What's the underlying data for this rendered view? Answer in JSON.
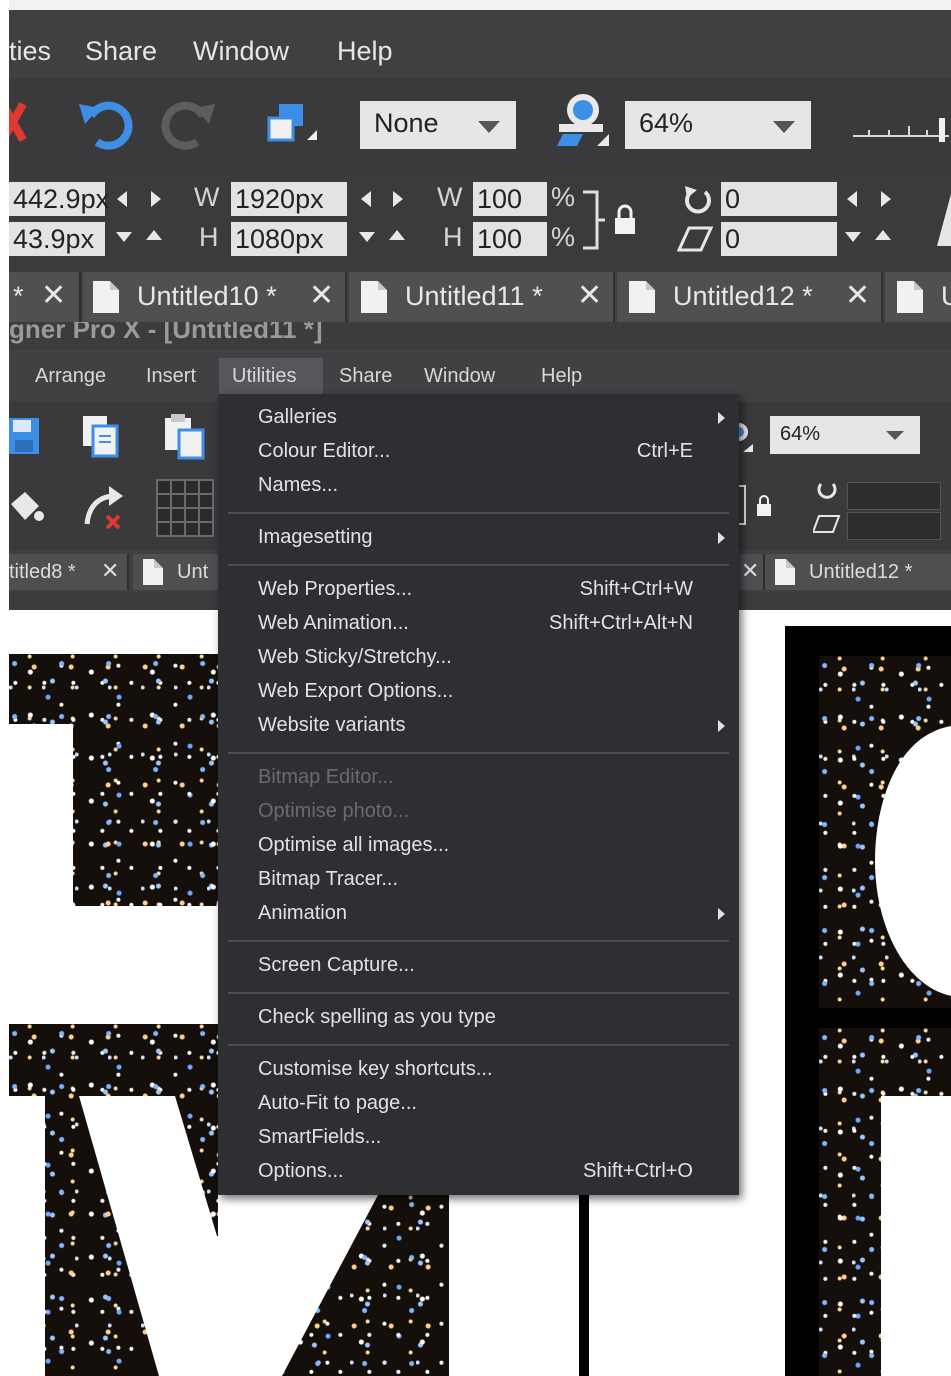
{
  "zoom_menu": {
    "items": [
      "ties",
      "Share",
      "Window",
      "Help"
    ]
  },
  "zoom_toolbar": {
    "style_value": "None",
    "zoom_value": "64%"
  },
  "zoom_fields": {
    "x_value": "442.9px",
    "y_value": "43.9px",
    "w_label": "W",
    "h_label": "H",
    "width_value": "1920px",
    "height_value": "1080px",
    "scale_w_label": "W",
    "scale_h_label": "H",
    "scale_w_value": "100",
    "scale_h_value": "100",
    "percent": "%",
    "rotate_value": "0",
    "skew_value": "0"
  },
  "zoom_tabs": {
    "tab_partial": "*",
    "tab1": "Untitled10 *",
    "tab2": "Untitled11 *",
    "tab3": "Untitled12 *",
    "tab4_partial": "U"
  },
  "window_title": "gner Pro X - [Untitled11 *]",
  "menubar": {
    "arrange": "Arrange",
    "insert": "Insert",
    "utilities": "Utilities",
    "share": "Share",
    "window": "Window",
    "help": "Help"
  },
  "toolbar2": {
    "zoom_value": "64%"
  },
  "tabs2": {
    "left_partial": "titled8 *",
    "mid_partial": "Unt",
    "right_tab": "Untitled12 *"
  },
  "utilities_menu": {
    "galleries": "Galleries",
    "colour_editor": "Colour Editor...",
    "colour_editor_shortcut": "Ctrl+E",
    "names": "Names...",
    "imagesetting": "Imagesetting",
    "web_properties": "Web Properties...",
    "web_properties_shortcut": "Shift+Ctrl+W",
    "web_animation": "Web Animation...",
    "web_animation_shortcut": "Shift+Ctrl+Alt+N",
    "web_sticky": "Web Sticky/Stretchy...",
    "web_export": "Web Export Options...",
    "website_variants": "Website variants",
    "bitmap_editor": "Bitmap Editor...",
    "optimise_photo": "Optimise photo...",
    "optimise_all": "Optimise all images...",
    "bitmap_tracer": "Bitmap Tracer...",
    "animation": "Animation",
    "screen_capture": "Screen Capture...",
    "check_spelling": "Check spelling as you type",
    "customise_keys": "Customise key shortcuts...",
    "auto_fit": "Auto-Fit to page...",
    "smartfields": "SmartFields...",
    "options": "Options...",
    "options_shortcut": "Shift+Ctrl+O"
  },
  "colors": {
    "menu_bg": "#2e2f32",
    "toolbar_bg": "#3a3a3c",
    "text": "#e2e2e2",
    "disabled_text": "#6b6b6e",
    "accent_blue": "#3d8ee6"
  }
}
